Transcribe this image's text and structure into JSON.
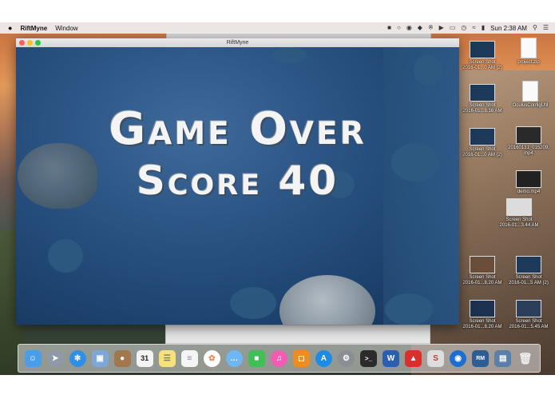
{
  "menubar": {
    "apple": "",
    "app_name": "RiftMyne",
    "menu_window": "Window",
    "clock": "Sun 2:38 AM"
  },
  "window": {
    "title": "RiftMyne"
  },
  "game": {
    "line1": "Game Over",
    "line2": "Score 40"
  },
  "desktop": {
    "icons": [
      {
        "label1": "Screen Shot",
        "label2": "2016-01...0 AM (2)"
      },
      {
        "label1": "project.zip",
        "label2": ""
      },
      {
        "label1": "Screen Shot",
        "label2": "2016-01...8.16 AM"
      },
      {
        "label1": "OculusConfigUtil",
        "label2": ""
      },
      {
        "label1": "Screen Shot",
        "label2": "2016-01...0 AM (2)"
      },
      {
        "label1": "20160131_015209.",
        "label2": "mp4"
      },
      {
        "label1": "demo.mp4",
        "label2": ""
      },
      {
        "label1": "Screen Shot",
        "label2": "2016-01...3.44 AM"
      },
      {
        "label1": "Screen Shot",
        "label2": "2016-01...8.20 AM"
      },
      {
        "label1": "Screen Shot",
        "label2": "2016-01...5 AM (2)"
      },
      {
        "label1": "Screen Shot",
        "label2": "2016-01...8.20 AM"
      },
      {
        "label1": "Screen Shot",
        "label2": "2016-01...5.45 AM"
      }
    ]
  },
  "dock": {
    "calendar_day": "31",
    "apps": [
      "finder",
      "launchpad",
      "safari",
      "preview",
      "contacts",
      "calendar",
      "notes",
      "reminders",
      "photos",
      "messages",
      "facetime",
      "itunes",
      "ibooks",
      "app-store",
      "system-preferences",
      "terminal",
      "word",
      "unknown",
      "scrivener",
      "browser",
      "riftmyne",
      "image-viewer",
      "trash"
    ]
  },
  "colors": {
    "menubar": "#ece9e9",
    "game_bg": "#1f4572",
    "title_text": "#f4f4f4"
  }
}
